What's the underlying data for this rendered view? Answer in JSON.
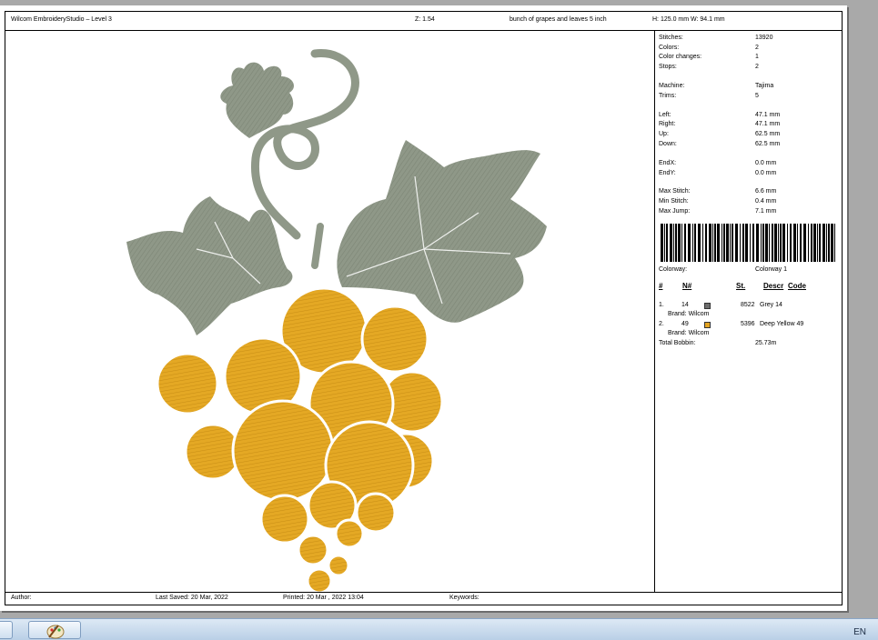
{
  "header": {
    "app_title": "Wilcom EmbroideryStudio – Level 3",
    "zoom": "Z: 1.54",
    "design_name": "bunch of grapes and leaves 5 inch",
    "dimensions": "H: 125.0 mm  W: 94.1 mm"
  },
  "stats": {
    "stitches_label": "Stitches:",
    "stitches": "13920",
    "colors_label": "Colors:",
    "colors": "2",
    "color_changes_label": "Color changes:",
    "color_changes": "1",
    "stops_label": "Stops:",
    "stops": "2",
    "machine_label": "Machine:",
    "machine": "Tajima",
    "trims_label": "Trims:",
    "trims": "5",
    "left_label": "Left:",
    "left": "47.1 mm",
    "right_label": "Right:",
    "right": "47.1 mm",
    "up_label": "Up:",
    "up": "62.5 mm",
    "down_label": "Down:",
    "down": "62.5 mm",
    "endx_label": "EndX:",
    "endx": "0.0 mm",
    "endy_label": "EndY:",
    "endy": "0.0 mm",
    "max_stitch_label": "Max Stitch:",
    "max_stitch": "6.6 mm",
    "min_stitch_label": "Min Stitch:",
    "min_stitch": "0.4 mm",
    "max_jump_label": "Max Jump:",
    "max_jump": "7.1 mm"
  },
  "colorway": {
    "label": "Colorway:",
    "value": "Colorway 1"
  },
  "table": {
    "headers": {
      "num": "#",
      "n": "N#",
      "st": "St.",
      "descr": "Descr",
      "code": "Code"
    },
    "rows": [
      {
        "idx": "1.",
        "n": "14",
        "color": "#6e6e6e",
        "st": "8522",
        "descr": "Grey 14",
        "brand": "Brand: Wilcom"
      },
      {
        "idx": "2.",
        "n": "49",
        "color": "#e3a422",
        "st": "5396",
        "descr": "Deep Yellow 49",
        "brand": "Brand: Wilcom"
      }
    ],
    "total_bobbin_label": "Total Bobbin:",
    "total_bobbin": "25.73m"
  },
  "footer": {
    "author": "Author:",
    "last_saved": "Last Saved: 20 Mar, 2022",
    "printed": "Printed: 20 Mar , 2022 13:04",
    "keywords": "Keywords:"
  },
  "taskbar": {
    "language": "EN"
  },
  "design_colors": {
    "leaf": "#8f9888",
    "grape": "#e4a824"
  }
}
